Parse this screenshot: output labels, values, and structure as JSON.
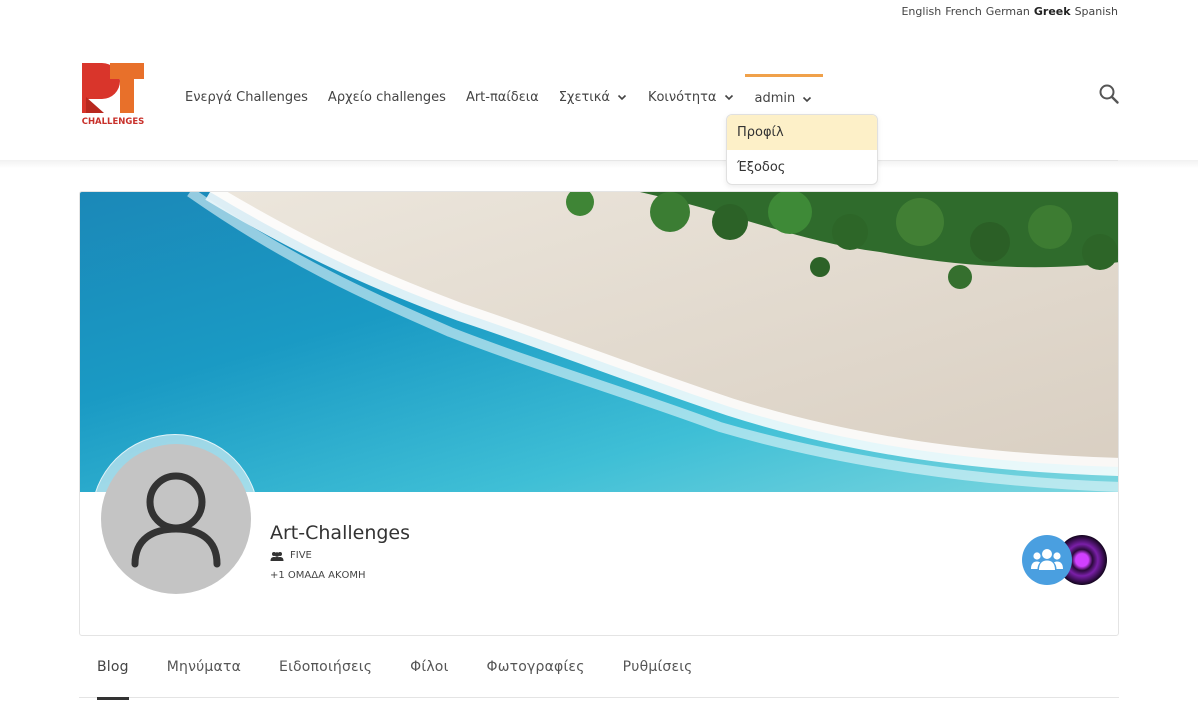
{
  "languages": [
    {
      "label": "English",
      "active": false
    },
    {
      "label": "French",
      "active": false
    },
    {
      "label": "German",
      "active": false
    },
    {
      "label": "Greek",
      "active": true
    },
    {
      "label": "Spanish",
      "active": false
    }
  ],
  "logo": {
    "text": "CHALLENGES",
    "icon": "art-challenges-logo"
  },
  "nav": {
    "items": [
      {
        "label": "Ενεργά Challenges"
      },
      {
        "label": "Αρχείο challenges"
      },
      {
        "label": "Art-παίδεια"
      },
      {
        "label": "Σχετικά"
      },
      {
        "label": "Κοινότητα"
      },
      {
        "label": "admin"
      }
    ],
    "search_icon": "search-icon",
    "accent_color": "#f0a14a"
  },
  "dropdown": {
    "items": [
      {
        "label": "Προφίλ"
      },
      {
        "label": "Έξοδος"
      }
    ]
  },
  "profile": {
    "name": "Art-Challenges",
    "group": "FIVE",
    "more_groups": "+1 ΟΜΑΔΑ ΑΚΟΜΗ"
  },
  "tabs": [
    {
      "label": "Blog",
      "active": true
    },
    {
      "label": "Μηνύματα"
    },
    {
      "label": "Ειδοποιήσεις"
    },
    {
      "label": "Φίλοι"
    },
    {
      "label": "Φωτογραφίες"
    },
    {
      "label": "Ρυθμίσεις"
    }
  ],
  "colors": {
    "group_button": "#4a9fe0",
    "dropdown_hover": "#fdf0c8"
  }
}
